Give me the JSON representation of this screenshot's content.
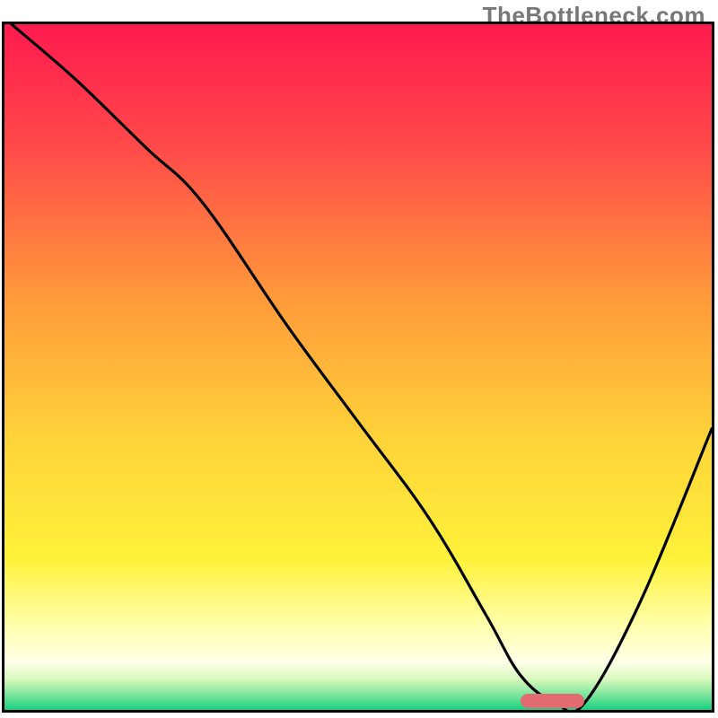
{
  "watermark": "TheBottleneck.com",
  "chart_data": {
    "type": "line",
    "title": "",
    "xlabel": "",
    "ylabel": "",
    "xlim": [
      0,
      100
    ],
    "ylim": [
      0,
      100
    ],
    "x": [
      1,
      10,
      20,
      28,
      40,
      50,
      60,
      68,
      73,
      78,
      82,
      90,
      100
    ],
    "values": [
      100,
      92,
      82,
      74,
      56,
      42,
      28,
      14,
      5,
      1,
      1,
      16,
      41
    ],
    "optimal_range_x": [
      73,
      82
    ],
    "gradient_stops": [
      {
        "pos": 0.0,
        "color": "#ff1a4e"
      },
      {
        "pos": 0.18,
        "color": "#ff4a4a"
      },
      {
        "pos": 0.4,
        "color": "#ff9a3a"
      },
      {
        "pos": 0.6,
        "color": "#ffd23a"
      },
      {
        "pos": 0.78,
        "color": "#fff23a"
      },
      {
        "pos": 0.88,
        "color": "#ffffb0"
      },
      {
        "pos": 0.93,
        "color": "#ffffe8"
      },
      {
        "pos": 0.955,
        "color": "#d9f9bf"
      },
      {
        "pos": 0.975,
        "color": "#88e8a0"
      },
      {
        "pos": 1.0,
        "color": "#18cf7f"
      }
    ],
    "optimal_bar_color": "#e16b6e"
  }
}
